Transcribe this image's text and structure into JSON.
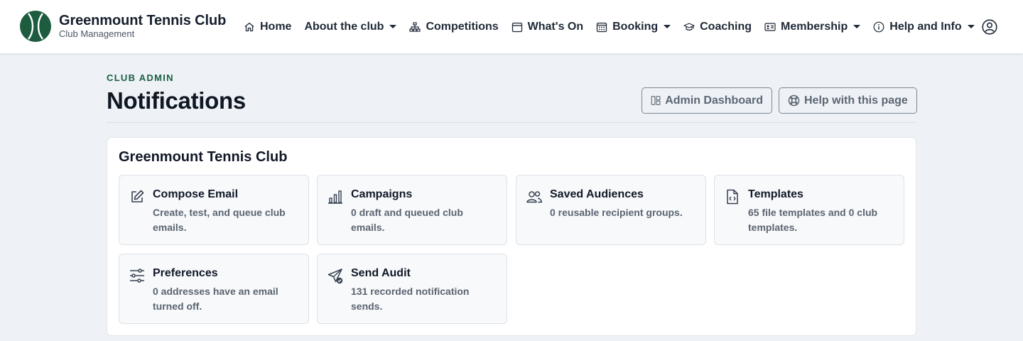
{
  "brand": {
    "title": "Greenmount Tennis Club",
    "subtitle": "Club Management",
    "logo_icon": "tennis-ball-icon",
    "logo_color": "#1d5c3f"
  },
  "nav": {
    "items": [
      {
        "label": "Home",
        "icon": "home-icon",
        "dropdown": false
      },
      {
        "label": "About the club",
        "icon": null,
        "dropdown": true
      },
      {
        "label": "Competitions",
        "icon": "sitemap-icon",
        "dropdown": false
      },
      {
        "label": "What's On",
        "icon": "calendar-icon",
        "dropdown": false
      },
      {
        "label": "Booking",
        "icon": "calendar-grid-icon",
        "dropdown": true
      },
      {
        "label": "Coaching",
        "icon": "graduation-cap-icon",
        "dropdown": false
      },
      {
        "label": "Membership",
        "icon": "id-card-icon",
        "dropdown": true
      },
      {
        "label": "Help and Info",
        "icon": "info-icon",
        "dropdown": true
      }
    ],
    "profile_icon": "user-circle-icon"
  },
  "header": {
    "eyebrow": "CLUB ADMIN",
    "title": "Notifications",
    "buttons": {
      "dashboard": {
        "label": "Admin Dashboard",
        "icon": "layout-icon"
      },
      "help": {
        "label": "Help with this page",
        "icon": "lifebuoy-icon"
      }
    }
  },
  "card": {
    "title": "Greenmount Tennis Club",
    "tiles": [
      {
        "title": "Compose Email",
        "desc": "Create, test, and queue club emails.",
        "icon": "pencil-square-icon"
      },
      {
        "title": "Campaigns",
        "desc": "0 draft and queued club emails.",
        "icon": "bar-chart-icon"
      },
      {
        "title": "Saved Audiences",
        "desc": "0 reusable recipient groups.",
        "icon": "people-icon"
      },
      {
        "title": "Templates",
        "desc": "65 file templates and 0 club templates.",
        "icon": "file-code-icon"
      },
      {
        "title": "Preferences",
        "desc": "0 addresses have an email turned off.",
        "icon": "sliders-icon"
      },
      {
        "title": "Send Audit",
        "desc": "131 recorded notification sends.",
        "icon": "send-check-icon"
      }
    ]
  },
  "colors": {
    "accent_green": "#1a5e42",
    "page_bg": "#eef2f6",
    "text_dark": "#111827",
    "text_muted": "#5b6470"
  }
}
